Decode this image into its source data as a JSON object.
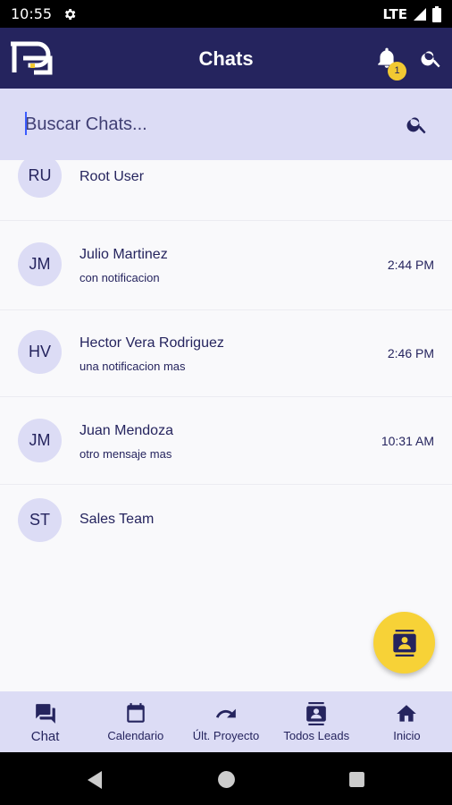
{
  "status_bar": {
    "time": "10:55",
    "network": "LTE"
  },
  "header": {
    "title": "Chats",
    "notification_count": "1"
  },
  "search": {
    "placeholder": "Buscar Chats..."
  },
  "chats": [
    {
      "initials": "RU",
      "name": "Root User",
      "message": "",
      "time": ""
    },
    {
      "initials": "JM",
      "name": "Julio Martinez",
      "message": "con notificacion",
      "time": "2:44 PM"
    },
    {
      "initials": "HV",
      "name": "Hector Vera Rodriguez",
      "message": "una notificacion mas",
      "time": "2:46 PM"
    },
    {
      "initials": "JM",
      "name": "Juan Mendoza",
      "message": "otro mensaje mas",
      "time": "10:31 AM"
    },
    {
      "initials": "ST",
      "name": "Sales Team",
      "message": "",
      "time": ""
    }
  ],
  "bottom_nav": [
    {
      "label": "Chat",
      "icon": "chat-icon"
    },
    {
      "label": "Calendario",
      "icon": "calendar-icon"
    },
    {
      "label": "Últ. Proyecto",
      "icon": "redo-icon"
    },
    {
      "label": "Todos Leads",
      "icon": "contacts-icon"
    },
    {
      "label": "Inicio",
      "icon": "home-icon"
    }
  ],
  "colors": {
    "primary": "#25245e",
    "accent": "#f7d237",
    "panel": "#dcdcf5"
  }
}
